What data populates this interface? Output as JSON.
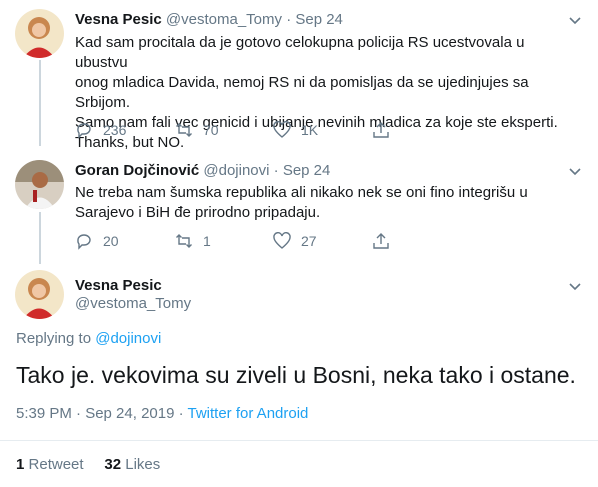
{
  "tweet1": {
    "name": "Vesna Pesic",
    "handle": "@vestoma_Tomy",
    "date": "Sep 24",
    "text_lines": [
      "Kad sam procitala da je gotovo celokupna policija RS ucestvovala u ubustvu",
      "onog mladica Davida, nemoj RS ni da pomisljas da se ujedinjujes sa Srbijom.",
      "Samo nam fali vec genicid i ubijanje  nevinih mladica za koje ste eksperti.",
      "Thanks, but NO."
    ],
    "replies": "236",
    "retweets": "70",
    "likes": "1K"
  },
  "tweet2": {
    "name": "Goran Dojčinović",
    "handle": "@dojinovi",
    "date": "Sep 24",
    "text_lines": [
      "Ne treba nam šumska republika ali nikako nek se oni fino integrišu u",
      "Sarajevo i BiH đe prirodno pripadaju."
    ],
    "replies": "20",
    "retweets": "1",
    "likes": "27"
  },
  "main": {
    "name": "Vesna Pesic",
    "handle": "@vestoma_Tomy",
    "replying_prefix": "Replying to",
    "replying_to": "@dojinovi",
    "text": "Tako je. vekovima su ziveli u Bosni, neka tako i ostane.",
    "time": "5:39 PM · Sep 24, 2019 · ",
    "source": "Twitter for Android",
    "retweet_count": "1",
    "retweet_label": "Retweet",
    "like_count": "32",
    "like_label": "Likes"
  },
  "sep": "·",
  "colors": {
    "link": "#1da1f2",
    "muted": "#657786",
    "text": "#14171a",
    "divider": "#e6ecf0"
  }
}
